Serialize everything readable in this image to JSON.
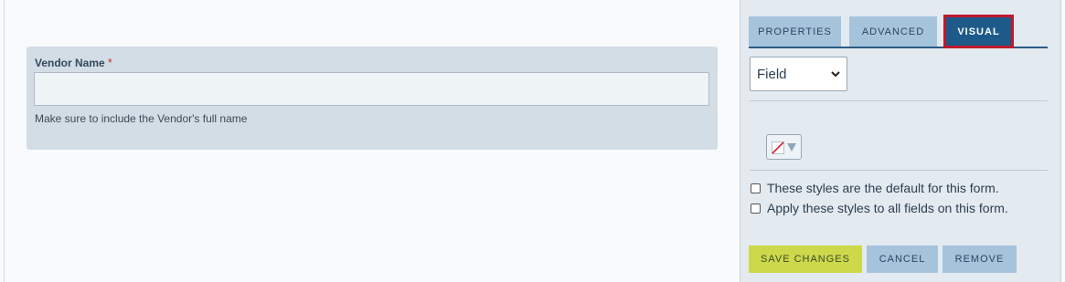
{
  "form_canvas": {
    "field": {
      "label": "Vendor Name",
      "required_marker": "*",
      "value": "",
      "help_text": "Make sure to include the Vendor's full name"
    }
  },
  "properties_panel": {
    "tabs": [
      {
        "label": "PROPERTIES",
        "active": false
      },
      {
        "label": "ADVANCED",
        "active": false
      },
      {
        "label": "VISUAL",
        "active": true
      }
    ],
    "target_select": {
      "selected": "Field"
    },
    "color_picker": {
      "icon": "no-color-icon",
      "caret_icon": "caret-down-icon"
    },
    "options": [
      {
        "label": "These styles are the default for this form.",
        "checked": false
      },
      {
        "label": "Apply these styles to all fields on this form.",
        "checked": false
      }
    ],
    "actions": {
      "save_label": "SAVE CHANGES",
      "cancel_label": "CANCEL",
      "remove_label": "REMOVE"
    },
    "colors": {
      "active_tab": "#1d5a8a",
      "active_tab_outline": "#c0182b",
      "tab": "#a6c3dc",
      "save_button": "#cdd94a"
    }
  }
}
